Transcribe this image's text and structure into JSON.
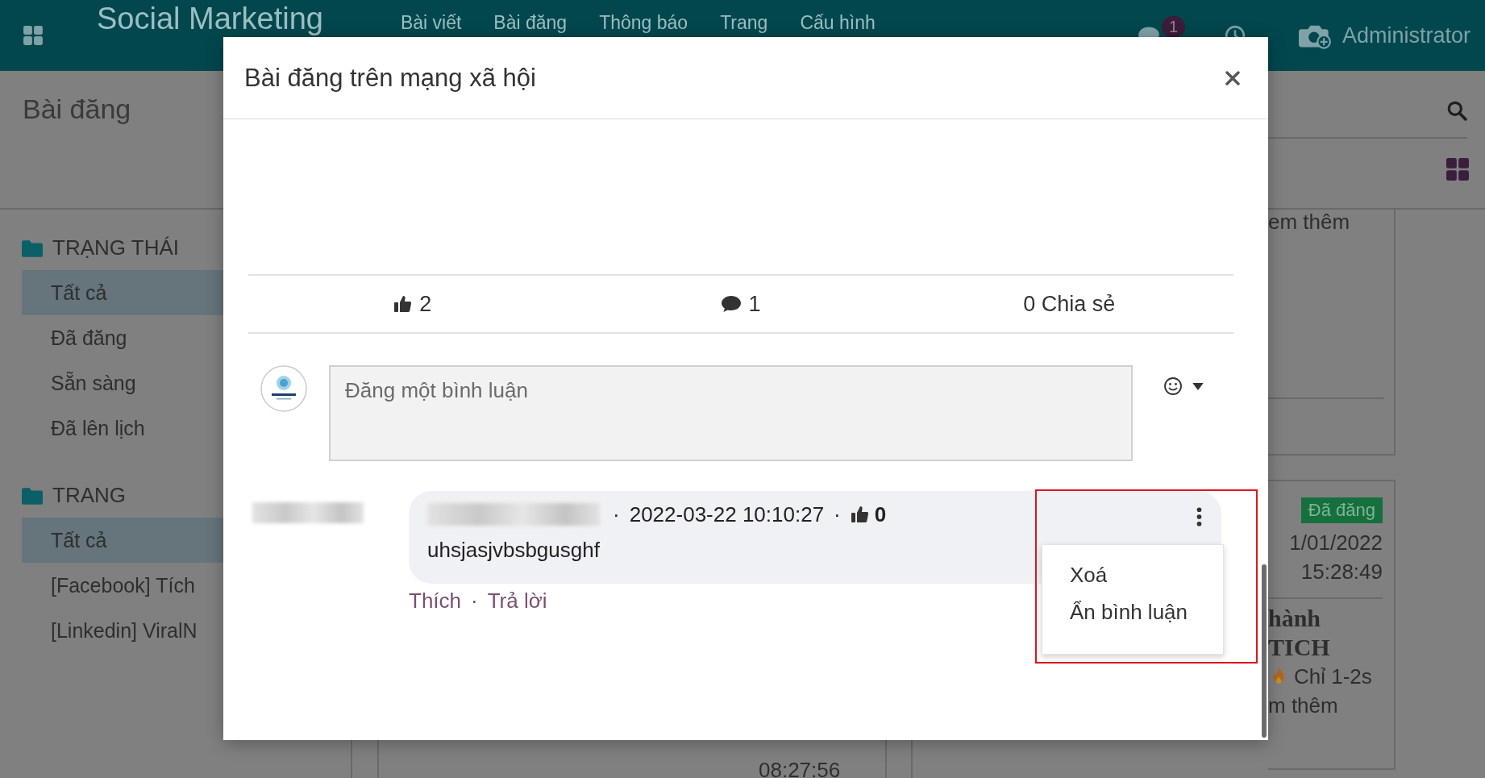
{
  "navbar": {
    "app_title": "Social Marketing",
    "menu": [
      "Bài viết",
      "Bài đăng",
      "Thông báo",
      "Trang",
      "Cấu hình"
    ],
    "message_count": "1",
    "user": "Administrator"
  },
  "control_panel": {
    "title": "Bài đăng"
  },
  "sidebar": {
    "sections": [
      {
        "title": "TRẠNG THÁI",
        "items": [
          {
            "label": "Tất cả",
            "selected": true
          },
          {
            "label": "Đã đăng",
            "selected": false
          },
          {
            "label": "Sẵn sàng",
            "selected": false
          },
          {
            "label": "Đã lên lịch",
            "selected": false
          }
        ]
      },
      {
        "title": "TRANG",
        "items": [
          {
            "label": "Tất cả",
            "selected": true
          },
          {
            "label": "[Facebook] Tích",
            "selected": false
          },
          {
            "label": "[Linkedin] ViralN",
            "selected": false
          }
        ]
      }
    ]
  },
  "background_cards": [
    {
      "more_link": "em thêm"
    },
    {
      "status": "Đã đăng",
      "date": "1/01/2022",
      "time": "15:28:49",
      "heading_lines": [
        "hành",
        "TICH"
      ],
      "text_lines": [
        "Chỉ 1-2s",
        "m thêm"
      ]
    }
  ],
  "background_bottom": {
    "time": "08:27:56"
  },
  "dialog": {
    "title": "Bài đăng trên mạng xã hội",
    "stats": {
      "likes": "2",
      "comments": "1",
      "shares": "0 Chia sẻ"
    },
    "comment_input": {
      "placeholder": "Đăng một bình luận"
    },
    "comments": [
      {
        "separator": "·",
        "date": "2022-03-22 10:10:27",
        "likes": "0",
        "text": "uhsjasjvbsbgusghf",
        "actions": [
          "Thích",
          "Trả lời"
        ],
        "menu": {
          "open": true,
          "items": [
            "Xoá",
            "Ẩn bình luận"
          ]
        }
      }
    ]
  }
}
